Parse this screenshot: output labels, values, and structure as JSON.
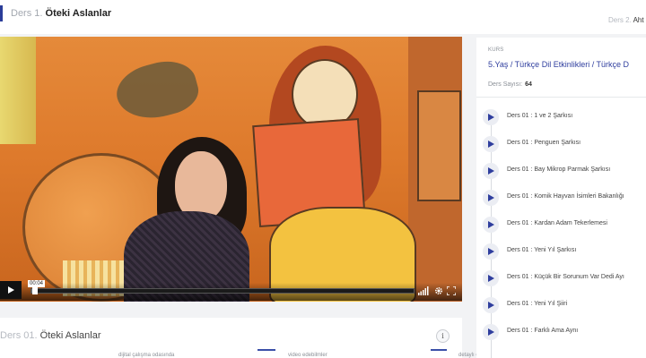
{
  "header": {
    "current_prefix": "Ders 1.",
    "current_title": "Öteki Aslanlar",
    "next_prefix": "Ders 2.",
    "next_title": "Aht"
  },
  "video": {
    "current_time": "00:04",
    "progress": 0.01
  },
  "lesson": {
    "prefix": "Ders 01.",
    "title": "Öteki Aslanlar",
    "info_symbol": "i"
  },
  "bottom_tabs": [
    {
      "label": "dijital çalışma odasında"
    },
    {
      "label": "video edebilmler"
    },
    {
      "label": "detaylı çözümler"
    }
  ],
  "course": {
    "label": "KURS",
    "title": "5.Yaş / Türkçe Dil Etkinlikleri / Türkçe D",
    "count_label": "Ders Sayısı:",
    "count_value": "64",
    "items": [
      {
        "label": "Ders 01 : 1 ve 2 Şarkısı"
      },
      {
        "label": "Ders 01 : Penguen Şarkısı"
      },
      {
        "label": "Ders 01 : Bay Mikrop Parmak Şarkısı"
      },
      {
        "label": "Ders 01 : Komik Hayvan İsimleri Bakanlığı"
      },
      {
        "label": "Ders 01 : Kardan Adam Tekerlemesi"
      },
      {
        "label": "Ders 01 : Yeni Yıl Şarkısı"
      },
      {
        "label": "Ders 01 : Küçük Bir Sorunum Var Dedi Ayı"
      },
      {
        "label": "Ders 01 : Yeni Yıl Şiiri"
      },
      {
        "label": "Ders 01 : Farklı Ama Aynı"
      }
    ]
  },
  "colors": {
    "accent": "#2f3e9e",
    "panel_bg": "#ffffff",
    "page_bg": "#f2f3f5"
  },
  "icons": {
    "play": "play-icon",
    "volume": "volume-bars-icon",
    "settings": "gear-icon",
    "fullscreen": "fullscreen-icon",
    "info": "info-icon"
  }
}
